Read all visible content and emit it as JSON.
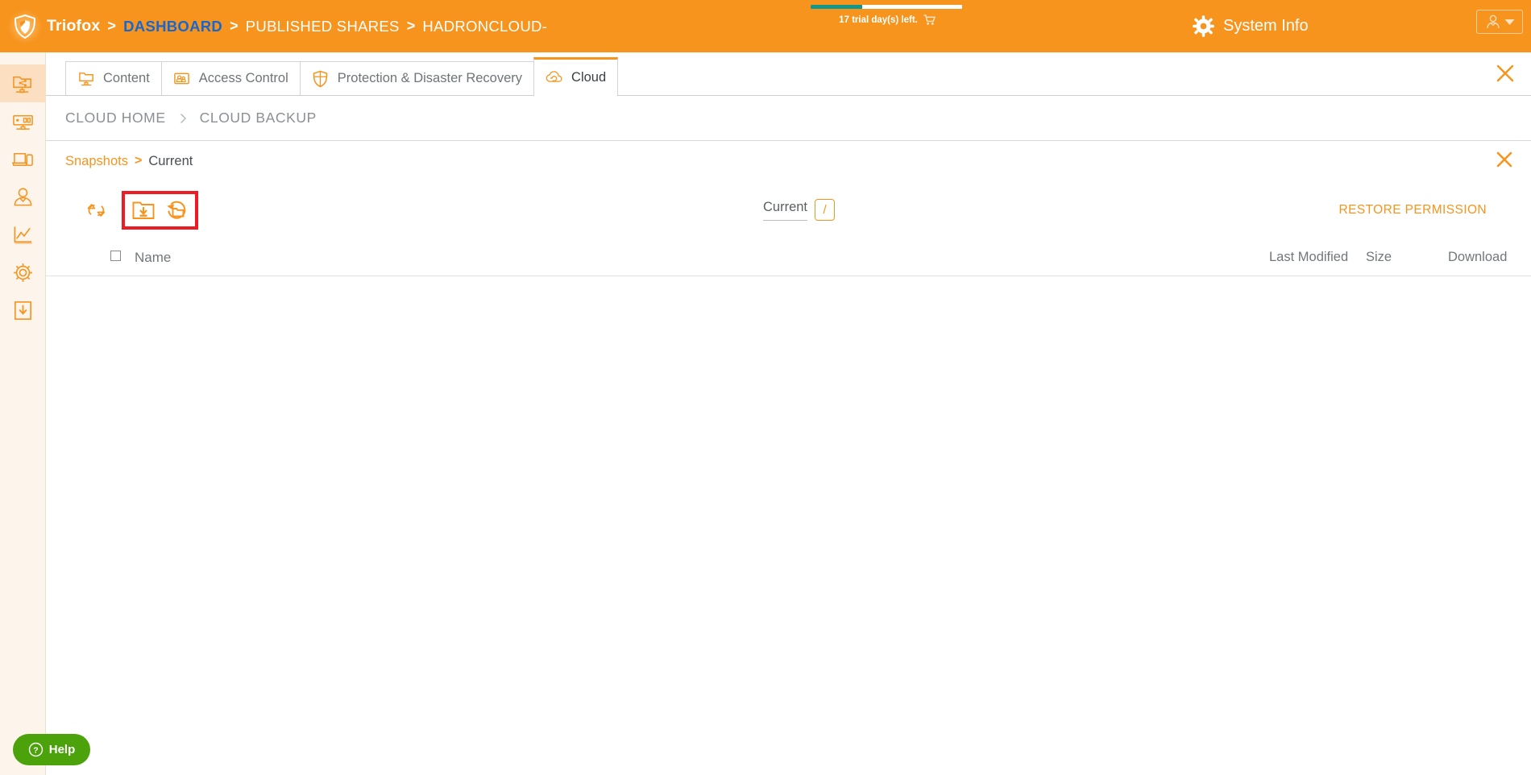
{
  "topbar": {
    "brand": "Triofox",
    "sep": ">",
    "crumb_dashboard": "DASHBOARD",
    "crumb_published": "PUBLISHED SHARES",
    "crumb_current": "HADRONCLOUD-",
    "trial_text": "17 trial day(s) left.",
    "cart_icon": "cart-icon",
    "system_info": "System Info",
    "gear_icon": "gear-icon",
    "avatar_icon": "user-avatar-icon",
    "chevron_icon": "chevron-down-icon",
    "bg_color": "#F7941E",
    "link_color": "#1667cf",
    "trial_fill_color": "#12988a"
  },
  "sidebar": {
    "items": [
      {
        "name": "shared-folder",
        "icon": "shared-folder-icon",
        "active": true
      },
      {
        "name": "server",
        "icon": "server-monitor-icon",
        "active": false
      },
      {
        "name": "devices",
        "icon": "devices-icon",
        "active": false
      },
      {
        "name": "users",
        "icon": "user-icon",
        "active": false
      },
      {
        "name": "reports",
        "icon": "chart-line-icon",
        "active": false
      },
      {
        "name": "settings",
        "icon": "gear-icon",
        "active": false
      },
      {
        "name": "downloads",
        "icon": "download-box-icon",
        "active": false
      }
    ]
  },
  "tabs": [
    {
      "label": "Content",
      "icon": "folder-network-icon",
      "active": false
    },
    {
      "label": "Access Control",
      "icon": "user-permissions-icon",
      "active": false
    },
    {
      "label": "Protection & Disaster Recovery",
      "icon": "shield-icon",
      "active": false
    },
    {
      "label": "Cloud",
      "icon": "cloud-sync-icon",
      "active": true
    }
  ],
  "cloud_breadcrumb": {
    "home": "CLOUD HOME",
    "arrow_icon": "chevron-right-icon",
    "backup": "CLOUD BACKUP"
  },
  "snapshots": {
    "link": "Snapshots",
    "separator": ">",
    "current": "Current",
    "close_icon": "close-icon"
  },
  "toolbar": {
    "refresh_icon": "sync-refresh-icon",
    "download_folder_icon": "download-folder-icon",
    "restore_folder_icon": "restore-folder-icon",
    "current_label": "Current",
    "path_slash": "/",
    "restore_permission": "RESTORE PERMISSION",
    "highlight_color": "#ED1C24",
    "accent_color": "#F7941E"
  },
  "table": {
    "columns": [
      "Name",
      "Last Modified",
      "Size",
      "Download"
    ],
    "rows": []
  },
  "help": {
    "label": "Help",
    "icon": "question-circle-icon",
    "color": "#4CA20A"
  },
  "close_tab_icon": "close-icon"
}
